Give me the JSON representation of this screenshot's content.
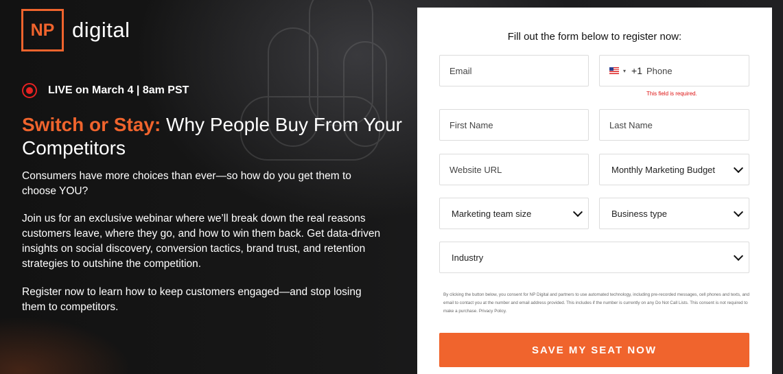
{
  "brand": {
    "logo_mark": "NP",
    "logo_word": "digital"
  },
  "event": {
    "live_text": "LIVE on March 4 | 8am PST"
  },
  "headline": {
    "accent": "Switch or Stay:",
    "rest": " Why People Buy From Your Competitors"
  },
  "body": {
    "p1": "Consumers have more choices than ever—so how do you get them to choose YOU?",
    "p2": "Join us for an exclusive webinar where we’ll break down the real reasons customers leave, where they go, and how to win them back. Get data-driven insights on social discovery, conversion tactics, brand trust, and retention strategies to outshine the competition.",
    "p3": "Register now to learn how to keep customers engaged—and stop losing them to competitors."
  },
  "form": {
    "title": "Fill out the form below to register now:",
    "email_placeholder": "Email",
    "phone_dial_code": "+1",
    "phone_placeholder": "Phone",
    "phone_error": "This field is required.",
    "first_name_placeholder": "First Name",
    "last_name_placeholder": "Last Name",
    "website_placeholder": "Website URL",
    "budget_select": "Monthly Marketing Budget",
    "team_size_select": "Marketing team size",
    "business_type_select": "Business type",
    "industry_select": "Industry",
    "consent_text": "By clicking the button below, you consent for NP Digital and partners to use automated technology, including pre-recorded messages, cell phones and texts, and email to contact you at the number and email address provided. This includes if the number is currently on any Do Not Call Lists. This consent is not required to make a purchase.",
    "privacy_link": "Privacy Policy.",
    "submit_label": "SAVE MY SEAT NOW"
  },
  "colors": {
    "accent": "#f0642d",
    "live_red": "#e52222",
    "error_red": "#dd1111"
  },
  "icons": [
    "live-indicator-icon",
    "us-flag-icon",
    "chevron-down-icon"
  ]
}
